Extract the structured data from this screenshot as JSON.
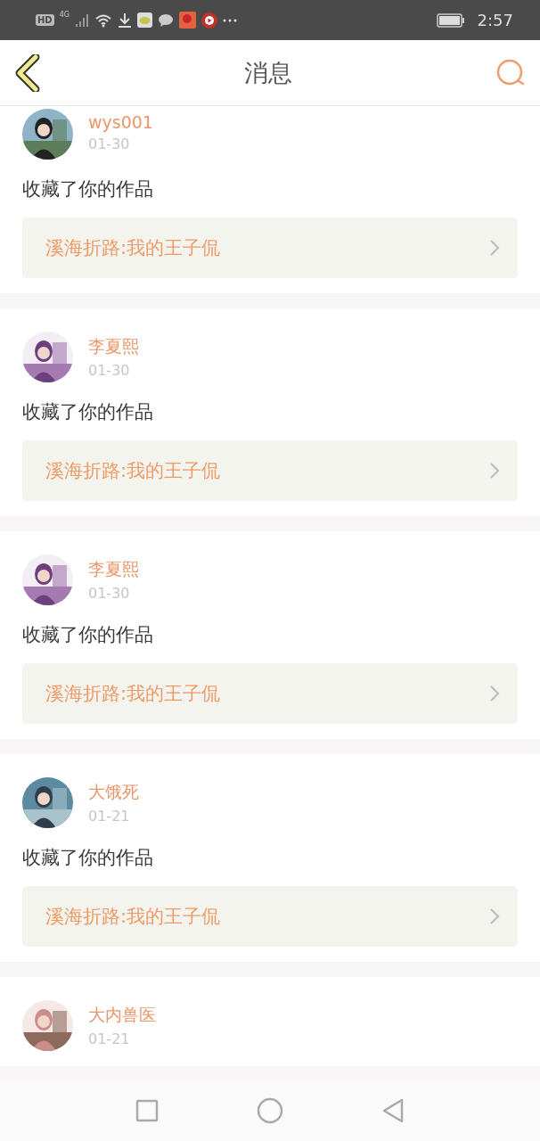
{
  "status_bar": {
    "hd_label": "HD",
    "network_label": "4G",
    "time": "2:57"
  },
  "header": {
    "title": "消息"
  },
  "messages": [
    {
      "user": "wys001",
      "date": "01-30",
      "action": "收藏了你的作品",
      "work": "溪海折路:我的王子侃"
    },
    {
      "user": "李夏熙",
      "date": "01-30",
      "action": "收藏了你的作品",
      "work": "溪海折路:我的王子侃"
    },
    {
      "user": "李夏熙",
      "date": "01-30",
      "action": "收藏了你的作品",
      "work": "溪海折路:我的王子侃"
    },
    {
      "user": "大饿死",
      "date": "01-21",
      "action": "收藏了你的作品",
      "work": "溪海折路:我的王子侃"
    },
    {
      "user": "大内兽医",
      "date": "01-21"
    }
  ]
}
